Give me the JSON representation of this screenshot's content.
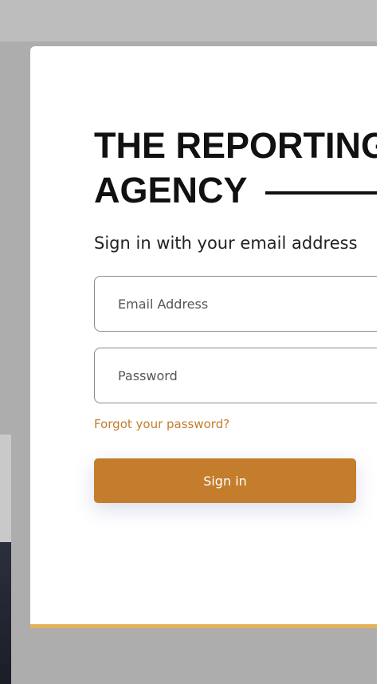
{
  "brand": {
    "line1": "THE REPORTING",
    "line2": "AGENCY"
  },
  "signin": {
    "subtitle": "Sign in with your email address",
    "email_placeholder": "Email Address",
    "password_placeholder": "Password",
    "forgot_label": "Forgot your password?",
    "submit_label": "Sign in"
  },
  "colors": {
    "accent": "#c47d2c",
    "link": "#c17d2c",
    "card_bottom_bar": "#e3b25a",
    "overlay": "#adadad"
  }
}
